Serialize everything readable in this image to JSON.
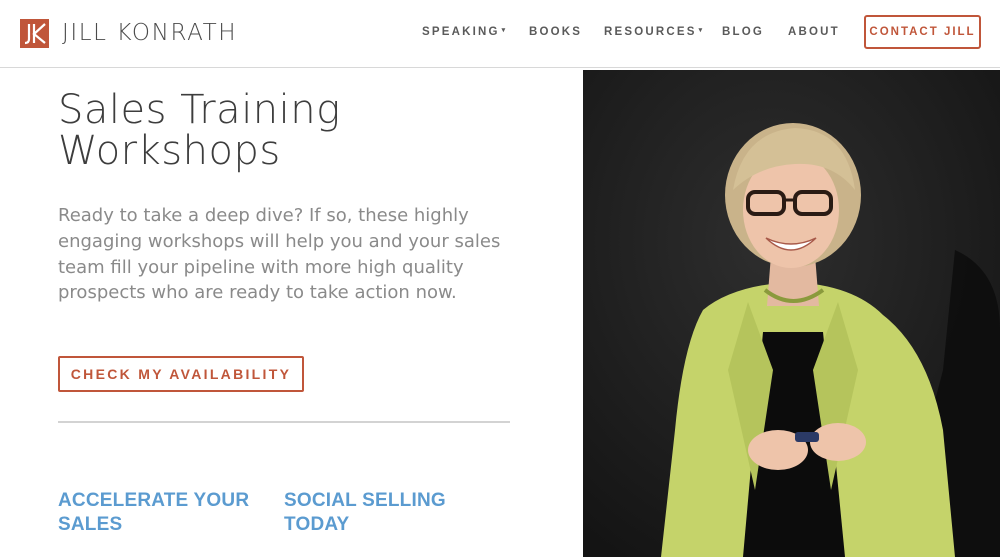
{
  "header": {
    "brand": "JILL KONRATH",
    "nav": [
      {
        "label": "SPEAKING",
        "has_dropdown": true
      },
      {
        "label": "BOOKS",
        "has_dropdown": false
      },
      {
        "label": "RESOURCES",
        "has_dropdown": true
      },
      {
        "label": "BLOG",
        "has_dropdown": false
      },
      {
        "label": "ABOUT",
        "has_dropdown": false
      }
    ],
    "contact_label": "CONTACT JILL"
  },
  "hero": {
    "title_line1": "Sales Training",
    "title_line2": "Workshops",
    "intro": "Ready to take a deep dive? If so, these highly engaging workshops will help you and your sales team fill your pipeline with more high quality prospects who are ready to take action now.",
    "cta_label": "CHECK MY AVAILABILITY"
  },
  "workshops": [
    {
      "line1": "ACCELERATE YOUR",
      "line2": "SALES"
    },
    {
      "line1": "SOCIAL SELLING",
      "line2": "TODAY"
    }
  ],
  "colors": {
    "brand_accent": "#c0563a",
    "link_blue": "#5b9bd0",
    "jacket_green": "#c5d36a",
    "photo_background": "#1e1e1e"
  },
  "icons": {
    "logo": "jk-monogram-icon",
    "dropdown": "caret-down-icon"
  }
}
